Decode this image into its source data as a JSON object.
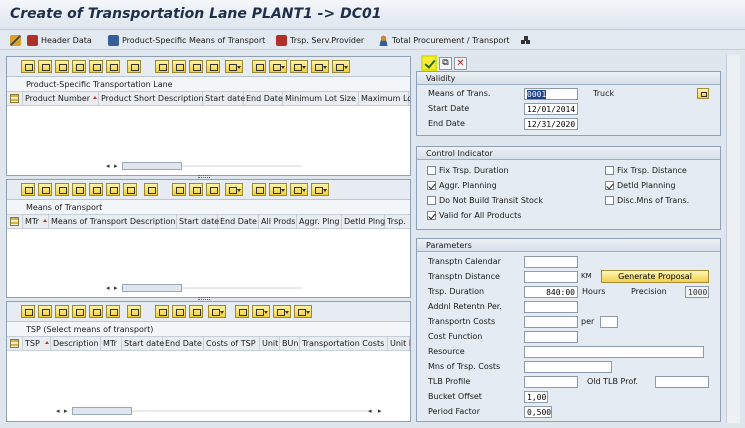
{
  "title": "Create of Transportation Lane PLANT1 -> DC01",
  "toolbar": {
    "header_data": "Header Data",
    "product_specific": "Product-Specific Means of Transport",
    "trsp_serv_provider": "Trsp. Serv.Provider",
    "total_procurement": "Total Procurement / Transport"
  },
  "panel1": {
    "title": "Product-Specific Transportation Lane",
    "columns": [
      "Product Number",
      "Product Short Description",
      "Start date",
      "End Date",
      "Minimum Lot Size",
      "Maximum Lo"
    ]
  },
  "panel2": {
    "title": "Means of Transport",
    "columns": [
      "MTr",
      "Means of Transport Description",
      "Start date",
      "End Date",
      "All Prods",
      "Aggr. Plng",
      "Detld Plng",
      "Trsp."
    ]
  },
  "panel3": {
    "title": "TSP (Select means of transport)",
    "columns": [
      "TSP",
      "Description",
      "MTr",
      "Start date",
      "End Date",
      "Costs of TSP",
      "Unit",
      "BUn",
      "Transportation Costs",
      "Unit F"
    ]
  },
  "validity": {
    "header": "Validity",
    "means_label": "Means of Trans.",
    "means_value": "0001",
    "means_desc": "Truck",
    "start_label": "Start Date",
    "start_value": "12/01/2014",
    "end_label": "End Date",
    "end_value": "12/31/2020"
  },
  "control": {
    "header": "Control Indicator",
    "fix_trsp_duration": "Fix Trsp. Duration",
    "fix_trsp_distance": "Fix Trsp. Distance",
    "aggr_planning": "Aggr. Planning",
    "detld_planning": "Detld Planning",
    "do_not_build": "Do Not Build Transit Stock",
    "disc_mns": "Disc.Mns of Trans.",
    "valid_all": "Valid for All Products"
  },
  "params": {
    "header": "Parameters",
    "calendar_label": "Transptn Calendar",
    "distance_label": "Transptn Distance",
    "distance_unit": "KM",
    "generate_btn": "Generate Proposal",
    "duration_label": "Trsp. Duration",
    "duration_value": "840:00",
    "duration_unit": "Hours",
    "precision_label": "Precision",
    "precision_value": "1000",
    "retention_label": "Addnl Retentn Per.",
    "costs_label": "Transportn Costs",
    "per_label": "per",
    "cost_function_label": "Cost Function",
    "resource_label": "Resource",
    "mns_costs_label": "Mns of Trsp. Costs",
    "tlb_label": "TLB Profile",
    "old_tlb_label": "Old TLB Prof.",
    "bucket_label": "Bucket Offset",
    "bucket_value": "1,00",
    "period_label": "Period Factor",
    "period_value": "0,500"
  }
}
